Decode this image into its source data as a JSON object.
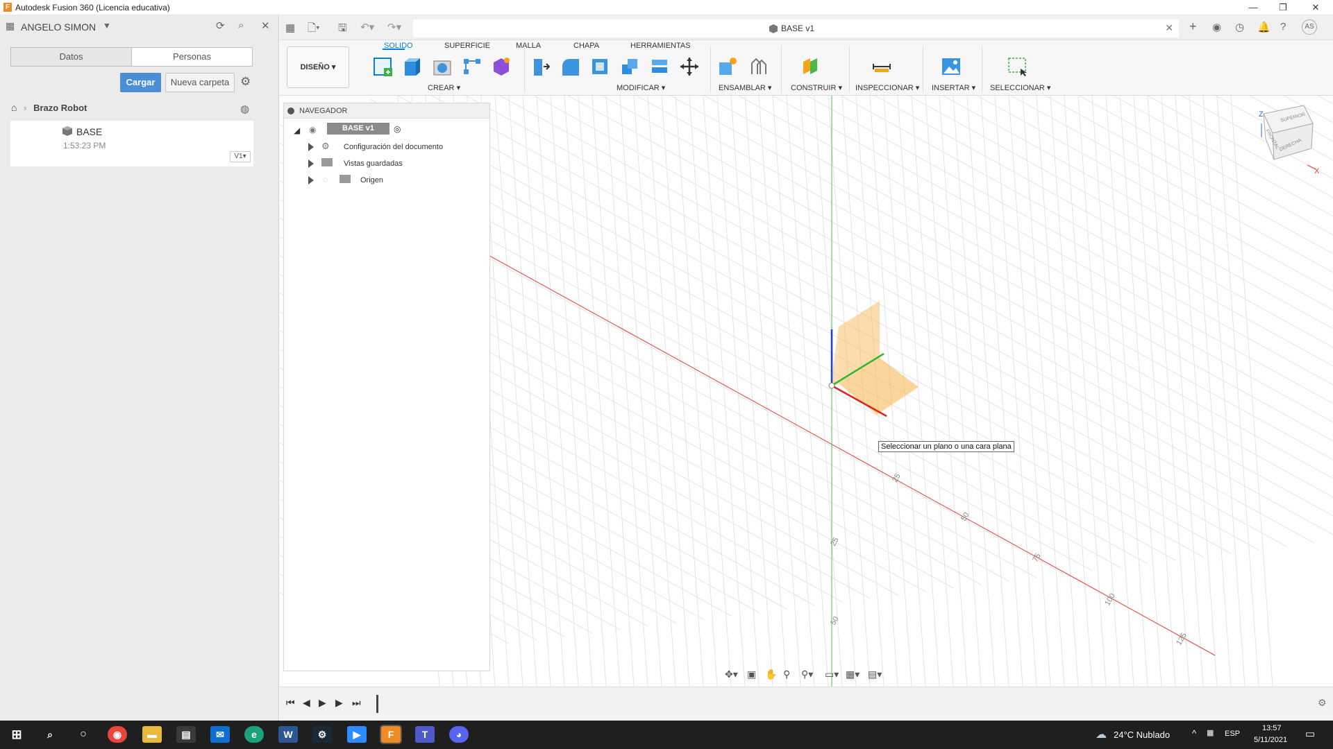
{
  "window": {
    "title": "Autodesk Fusion 360 (Licencia educativa)"
  },
  "data_panel": {
    "user": "ANGELO SIMON",
    "tabs": [
      "Datos",
      "Personas"
    ],
    "upload_label": "Cargar",
    "new_folder_label": "Nueva carpeta",
    "breadcrumb": "Brazo Robot",
    "file": {
      "name": "BASE",
      "time": "1:53:23 PM",
      "version": "V1"
    }
  },
  "document": {
    "tab_title": "BASE v1"
  },
  "ribbon": {
    "workspace": "DISEÑO",
    "tabs": [
      "SOLIDO",
      "SUPERFICIE",
      "MALLA",
      "CHAPA",
      "HERRAMIENTAS"
    ],
    "groups": [
      "CREAR",
      "MODIFICAR",
      "ENSAMBLAR",
      "CONSTRUIR",
      "INSPECCIONAR",
      "INSERTAR",
      "SELECCIONAR"
    ]
  },
  "browser": {
    "title": "NAVEGADOR",
    "root": "BASE v1",
    "items": [
      "Configuración del documento",
      "Vistas guardadas",
      "Origen"
    ]
  },
  "viewport": {
    "tooltip": "Seleccionar un plano o una cara plana",
    "ticks_x": [
      "25",
      "50",
      "75",
      "100",
      "125"
    ],
    "ticks_y": [
      "25",
      "50"
    ],
    "viewcube": {
      "top": "SUPERIOR",
      "front": "FRONTAL",
      "right": "DERECHA",
      "axis_z": "Z",
      "axis_x": "X"
    }
  },
  "taskbar": {
    "weather": "24°C  Nublado",
    "lang": "ESP",
    "time": "13:57",
    "date": "5/11/2021"
  },
  "colors": {
    "accent": "#0a7fd8",
    "cargar": "#4a8fd6",
    "x_axis": "#e02020",
    "y_axis": "#2db82d",
    "z_axis": "#1f3fcf",
    "plane": "#f8b24a"
  }
}
